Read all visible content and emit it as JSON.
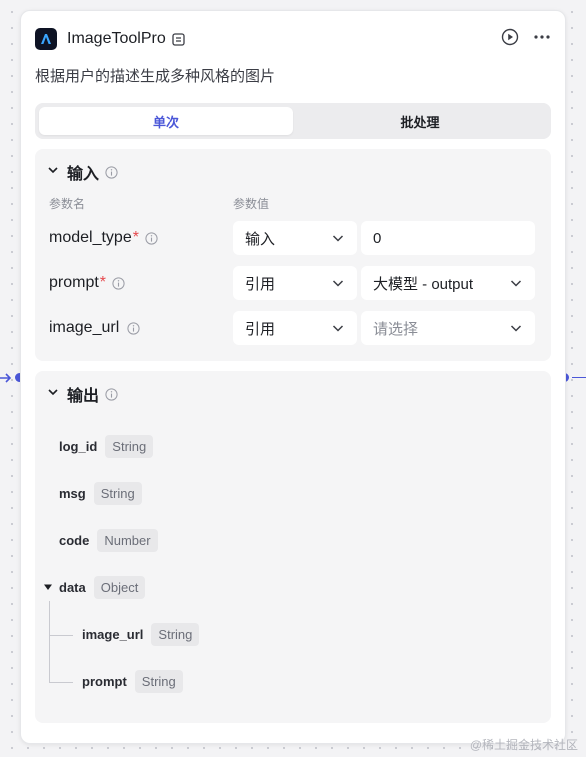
{
  "node": {
    "title": "ImageToolPro",
    "description": "根据用户的描述生成多种风格的图片",
    "icons": [
      "app-logo-icon",
      "node-badge-icon",
      "run-icon",
      "more-icon"
    ]
  },
  "mode_tabs": [
    {
      "label": "单次",
      "active": true
    },
    {
      "label": "批处理",
      "active": false
    }
  ],
  "input": {
    "title": "输入",
    "col_name": "参数名",
    "col_value": "参数值",
    "params": [
      {
        "name": "model_type",
        "required": "*",
        "source": "输入",
        "value": "0"
      },
      {
        "name": "prompt",
        "required": "*",
        "source": "引用",
        "value": "大模型 - output"
      },
      {
        "name": "image_url",
        "required": "",
        "source": "引用",
        "value": "请选择"
      }
    ]
  },
  "output": {
    "title": "输出",
    "fields": [
      {
        "name": "log_id",
        "type": "String"
      },
      {
        "name": "msg",
        "type": "String"
      },
      {
        "name": "code",
        "type": "Number"
      },
      {
        "name": "data",
        "type": "Object"
      },
      {
        "name": "image_url",
        "type": "String"
      },
      {
        "name": "prompt",
        "type": "String"
      }
    ]
  },
  "colors": {
    "accent": "#4b57d8",
    "required": "#e5484d"
  },
  "watermark": "@稀土掘金技术社区"
}
